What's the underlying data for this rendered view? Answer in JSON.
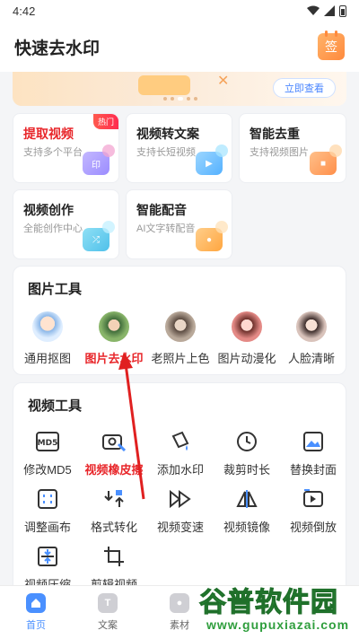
{
  "status_bar": {
    "time": "4:42"
  },
  "header": {
    "title": "快速去水印",
    "sign_label": "签"
  },
  "banner": {
    "cta": "立即查看"
  },
  "feature_cards": [
    {
      "title": "提取视频",
      "subtitle": "支持多个平台",
      "badge": "热门",
      "icon": "印",
      "highlight": true
    },
    {
      "title": "视频转文案",
      "subtitle": "支持长短视频",
      "icon": "play-icon"
    },
    {
      "title": "智能去重",
      "subtitle": "支持视频图片",
      "icon": "stack-icon"
    },
    {
      "title": "视频创作",
      "subtitle": "全能创作中心",
      "icon": "shuffle-icon"
    },
    {
      "title": "智能配音",
      "subtitle": "AI文字转配音",
      "icon": "mic-icon"
    }
  ],
  "image_tools": {
    "title": "图片工具",
    "items": [
      {
        "label": "通用抠图"
      },
      {
        "label": "图片去水印",
        "highlight": true
      },
      {
        "label": "老照片上色"
      },
      {
        "label": "图片动漫化"
      },
      {
        "label": "人脸清晰"
      }
    ]
  },
  "video_tools": {
    "title": "视频工具",
    "items": [
      {
        "label": "修改MD5",
        "icon": "md5-icon"
      },
      {
        "label": "视频橡皮擦",
        "icon": "eraser-icon",
        "highlight": true
      },
      {
        "label": "添加水印",
        "icon": "bucket-icon"
      },
      {
        "label": "裁剪时长",
        "icon": "clock-icon"
      },
      {
        "label": "替换封面",
        "icon": "image-icon"
      },
      {
        "label": "调整画布",
        "icon": "canvas-icon"
      },
      {
        "label": "格式转化",
        "icon": "convert-icon"
      },
      {
        "label": "视频变速",
        "icon": "speed-icon"
      },
      {
        "label": "视频镜像",
        "icon": "mirror-icon"
      },
      {
        "label": "视频倒放",
        "icon": "reverse-icon"
      },
      {
        "label": "视频压缩",
        "icon": "compress-icon"
      },
      {
        "label": "剪辑视频",
        "icon": "crop-icon"
      }
    ]
  },
  "tabbar": {
    "items": [
      {
        "label": "首页",
        "active": true
      },
      {
        "label": "文案",
        "icon_text": "T"
      },
      {
        "label": "素材"
      }
    ]
  },
  "watermark": {
    "brand": "谷普软件园",
    "url": "www.gupuxiazai.com"
  },
  "colors": {
    "accent_blue": "#4a90ff",
    "highlight_red": "#e8262a",
    "annotation_arrow": "#e02020"
  }
}
